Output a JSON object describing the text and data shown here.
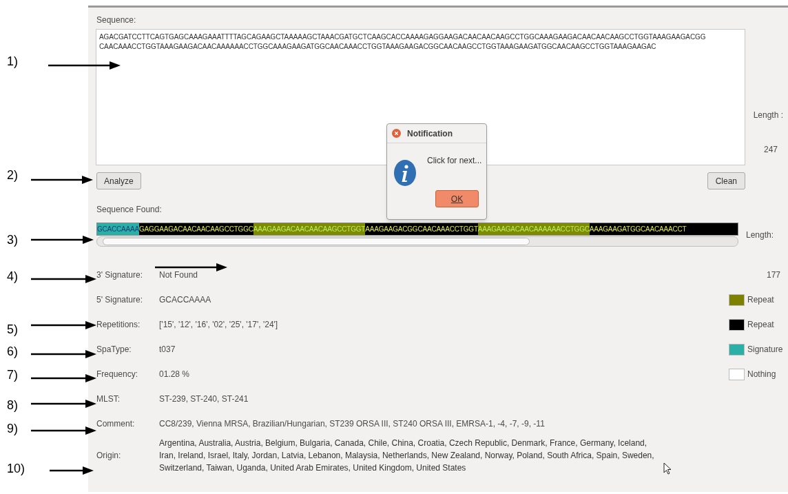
{
  "annotations": [
    {
      "label": "1)"
    },
    {
      "label": "2)"
    },
    {
      "label": "3)"
    },
    {
      "label": "4)"
    },
    {
      "label": "5)"
    },
    {
      "label": "6)"
    },
    {
      "label": "7)"
    },
    {
      "label": "8)"
    },
    {
      "label": "9)"
    },
    {
      "label": "10)"
    }
  ],
  "sequence": {
    "label": "Sequence:",
    "value": "AGACGATCCTTCAGTGAGCAAAGAAATTTTAGCAGAAGCTAAAAAGCTAAACGATGCTCAAGCACCAAAAGAGGAAGACAACAACAAGCCTGGCAAAGAAGACAACAACAAGCCTGGTAAAGAAGACGG CAACAAACCTGGTAAAGAAGACAACAAAAAACCTGGCAAAGAAGATGGCAACAAACCTGGTAAAGAAGACGGCAACAAGCCTGGTAAAGAAGATGGCAACAAGCCTGGTAAAGAAGAC",
    "length_label": "Length :",
    "length": "247"
  },
  "buttons": {
    "analyze": "Analyze",
    "clean": "Clean"
  },
  "sequence_found": {
    "label": "Sequence Found:",
    "length_label": "Length:",
    "segments": [
      {
        "text": "GCACCAAAA",
        "kind": "signature",
        "color": "#2ab0a6"
      },
      {
        "text": "GAGGAAGACAACAACAAGCCTGGC",
        "kind": "repeat",
        "color": "#000000"
      },
      {
        "text": "AAAGAAGACAACAACAAGCCTGGT",
        "kind": "repeat",
        "color": "#7e8a00"
      },
      {
        "text": "AAAGAAGACGGCAACAAACCTGGT",
        "kind": "repeat",
        "color": "#000000"
      },
      {
        "text": "AAAGAAGACAACAAAAAACCTGGC",
        "kind": "repeat",
        "color": "#7e8a00"
      },
      {
        "text": "AAAGAAGATGGCAACAAACCT",
        "kind": "repeat",
        "color": "#000000"
      }
    ]
  },
  "fields": [
    {
      "label": "3' Signature:",
      "value": "Not Found"
    },
    {
      "label": "5' Signature:",
      "value": "GCACCAAAA"
    },
    {
      "label": "Repetitions:",
      "value": "['15', '12', '16', '02', '25', '17', '24']"
    },
    {
      "label": "SpaType:",
      "value": "t037"
    },
    {
      "label": "Frequency:",
      "value": "01.28 %"
    },
    {
      "label": "MLST:",
      "value": "ST-239, ST-240, ST-241"
    },
    {
      "label": "Comment:",
      "value": "CC8/239, Vienna MRSA, Brazilian/Hungarian, ST239 ORSA III, ST240 ORSA III, EMRSA-1, -4, -7, -9, -11"
    },
    {
      "label": "Origin:",
      "value": "Argentina, Australia, Austria, Belgium, Bulgaria, Canada, Chile, China, Croatia, Czech Republic, Denmark, France, Germany, Iceland, Iran, Ireland, Israel, Italy, Jordan, Latvia, Lebanon, Malaysia, Netherlands, New Zealand, Norway, Poland, South Africa, Spain, Sweden, Switzerland, Taiwan, Uganda, United Arab Emirates, United Kingdom, United States"
    }
  ],
  "found_length": "177",
  "legend": [
    {
      "label": "Repeat",
      "color": "#7e8000"
    },
    {
      "label": "Repeat",
      "color": "#000000"
    },
    {
      "label": "Signature",
      "color": "#2ab0a6"
    },
    {
      "label": "Nothing",
      "color": "#ffffff"
    }
  ],
  "dialog": {
    "title": "Notification",
    "message": "Click for next...",
    "button": "OK"
  }
}
